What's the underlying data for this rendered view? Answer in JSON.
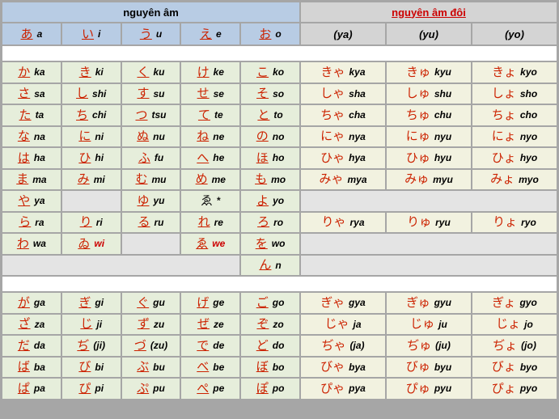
{
  "header": {
    "left_title": "nguyên âm",
    "right_title": "nguyên âm đôi",
    "vowels": [
      {
        "kana": "あ",
        "romaji": "a"
      },
      {
        "kana": "い",
        "romaji": "i"
      },
      {
        "kana": "う",
        "romaji": "u"
      },
      {
        "kana": "え",
        "romaji": "e"
      },
      {
        "kana": "お",
        "romaji": "o"
      }
    ],
    "diphthongs": [
      "(ya)",
      "(yu)",
      "(yo)"
    ]
  },
  "basic_rows": [
    {
      "id": "k",
      "left": [
        {
          "kana": "か",
          "romaji": "ka"
        },
        {
          "kana": "き",
          "romaji": "ki"
        },
        {
          "kana": "く",
          "romaji": "ku"
        },
        {
          "kana": "け",
          "romaji": "ke"
        },
        {
          "kana": "こ",
          "romaji": "ko"
        }
      ],
      "right": [
        {
          "kana": "きゃ",
          "romaji": "kya"
        },
        {
          "kana": "きゅ",
          "romaji": "kyu"
        },
        {
          "kana": "きょ",
          "romaji": "kyo"
        }
      ]
    },
    {
      "id": "s",
      "left": [
        {
          "kana": "さ",
          "romaji": "sa"
        },
        {
          "kana": "し",
          "romaji": "shi"
        },
        {
          "kana": "す",
          "romaji": "su"
        },
        {
          "kana": "せ",
          "romaji": "se"
        },
        {
          "kana": "そ",
          "romaji": "so"
        }
      ],
      "right": [
        {
          "kana": "しゃ",
          "romaji": "sha"
        },
        {
          "kana": "しゅ",
          "romaji": "shu"
        },
        {
          "kana": "しょ",
          "romaji": "sho"
        }
      ]
    },
    {
      "id": "t",
      "left": [
        {
          "kana": "た",
          "romaji": "ta"
        },
        {
          "kana": "ち",
          "romaji": "chi"
        },
        {
          "kana": "つ",
          "romaji": "tsu"
        },
        {
          "kana": "て",
          "romaji": "te"
        },
        {
          "kana": "と",
          "romaji": "to"
        }
      ],
      "right": [
        {
          "kana": "ちゃ",
          "romaji": "cha"
        },
        {
          "kana": "ちゅ",
          "romaji": "chu"
        },
        {
          "kana": "ちょ",
          "romaji": "cho"
        }
      ]
    },
    {
      "id": "n",
      "left": [
        {
          "kana": "な",
          "romaji": "na"
        },
        {
          "kana": "に",
          "romaji": "ni"
        },
        {
          "kana": "ぬ",
          "romaji": "nu"
        },
        {
          "kana": "ね",
          "romaji": "ne"
        },
        {
          "kana": "の",
          "romaji": "no"
        }
      ],
      "right": [
        {
          "kana": "にゃ",
          "romaji": "nya"
        },
        {
          "kana": "にゅ",
          "romaji": "nyu"
        },
        {
          "kana": "にょ",
          "romaji": "nyo"
        }
      ]
    },
    {
      "id": "h",
      "left": [
        {
          "kana": "は",
          "romaji": "ha"
        },
        {
          "kana": "ひ",
          "romaji": "hi"
        },
        {
          "kana": "ふ",
          "romaji": "fu"
        },
        {
          "kana": "へ",
          "romaji": "he"
        },
        {
          "kana": "ほ",
          "romaji": "ho"
        }
      ],
      "right": [
        {
          "kana": "ひゃ",
          "romaji": "hya"
        },
        {
          "kana": "ひゅ",
          "romaji": "hyu"
        },
        {
          "kana": "ひょ",
          "romaji": "hyo"
        }
      ]
    },
    {
      "id": "m",
      "left": [
        {
          "kana": "ま",
          "romaji": "ma"
        },
        {
          "kana": "み",
          "romaji": "mi"
        },
        {
          "kana": "む",
          "romaji": "mu"
        },
        {
          "kana": "め",
          "romaji": "me"
        },
        {
          "kana": "も",
          "romaji": "mo"
        }
      ],
      "right": [
        {
          "kana": "みゃ",
          "romaji": "mya"
        },
        {
          "kana": "みゅ",
          "romaji": "myu"
        },
        {
          "kana": "みょ",
          "romaji": "myo"
        }
      ]
    },
    {
      "id": "y",
      "left": [
        {
          "kana": "や",
          "romaji": "ya"
        },
        {
          "empty": true
        },
        {
          "kana": "ゆ",
          "romaji": "yu"
        },
        {
          "kana": "ゑ",
          "romaji": "",
          "black": true,
          "mark": "*"
        },
        {
          "kana": "よ",
          "romaji": "yo"
        }
      ],
      "right": [
        {
          "empty": true
        }
      ]
    },
    {
      "id": "r",
      "left": [
        {
          "kana": "ら",
          "romaji": "ra"
        },
        {
          "kana": "り",
          "romaji": "ri"
        },
        {
          "kana": "る",
          "romaji": "ru"
        },
        {
          "kana": "れ",
          "romaji": "re"
        },
        {
          "kana": "ろ",
          "romaji": "ro"
        }
      ],
      "right": [
        {
          "kana": "りゃ",
          "romaji": "rya"
        },
        {
          "kana": "りゅ",
          "romaji": "ryu"
        },
        {
          "kana": "りょ",
          "romaji": "ryo"
        }
      ]
    },
    {
      "id": "w",
      "left": [
        {
          "kana": "わ",
          "romaji": "wa"
        },
        {
          "kana": "ゐ",
          "romaji": "wi",
          "red_romaji": true
        },
        {
          "empty": true
        },
        {
          "kana": "ゑ",
          "romaji": "we",
          "red_romaji": true
        },
        {
          "kana": "を",
          "romaji": "wo"
        }
      ],
      "right": [
        {
          "empty": true
        }
      ]
    },
    {
      "id": "nn",
      "left": [
        {
          "empty_wide": true
        },
        {
          "kana": "ん",
          "romaji": "n"
        }
      ],
      "right": [
        {
          "empty": true
        }
      ]
    }
  ],
  "dakuten_rows": [
    {
      "id": "g",
      "left": [
        {
          "kana": "が",
          "romaji": "ga"
        },
        {
          "kana": "ぎ",
          "romaji": "gi"
        },
        {
          "kana": "ぐ",
          "romaji": "gu"
        },
        {
          "kana": "げ",
          "romaji": "ge"
        },
        {
          "kana": "ご",
          "romaji": "go"
        }
      ],
      "right": [
        {
          "kana": "ぎゃ",
          "romaji": "gya"
        },
        {
          "kana": "ぎゅ",
          "romaji": "gyu"
        },
        {
          "kana": "ぎょ",
          "romaji": "gyo"
        }
      ]
    },
    {
      "id": "z",
      "left": [
        {
          "kana": "ざ",
          "romaji": "za"
        },
        {
          "kana": "じ",
          "romaji": "ji"
        },
        {
          "kana": "ず",
          "romaji": "zu"
        },
        {
          "kana": "ぜ",
          "romaji": "ze"
        },
        {
          "kana": "ぞ",
          "romaji": "zo"
        }
      ],
      "right": [
        {
          "kana": "じゃ",
          "romaji": "ja"
        },
        {
          "kana": "じゅ",
          "romaji": "ju"
        },
        {
          "kana": "じょ",
          "romaji": "jo"
        }
      ]
    },
    {
      "id": "d",
      "left": [
        {
          "kana": "だ",
          "romaji": "da"
        },
        {
          "kana": "ぢ",
          "romaji": "(ji)"
        },
        {
          "kana": "づ",
          "romaji": "(zu)"
        },
        {
          "kana": "で",
          "romaji": "de"
        },
        {
          "kana": "ど",
          "romaji": "do"
        }
      ],
      "right": [
        {
          "kana": "ぢゃ",
          "romaji": "(ja)"
        },
        {
          "kana": "ぢゅ",
          "romaji": "(ju)"
        },
        {
          "kana": "ぢょ",
          "romaji": "(jo)"
        }
      ]
    },
    {
      "id": "b",
      "left": [
        {
          "kana": "ば",
          "romaji": "ba"
        },
        {
          "kana": "び",
          "romaji": "bi"
        },
        {
          "kana": "ぶ",
          "romaji": "bu"
        },
        {
          "kana": "べ",
          "romaji": "be"
        },
        {
          "kana": "ぼ",
          "romaji": "bo"
        }
      ],
      "right": [
        {
          "kana": "びゃ",
          "romaji": "bya"
        },
        {
          "kana": "びゅ",
          "romaji": "byu"
        },
        {
          "kana": "びょ",
          "romaji": "byo"
        }
      ]
    },
    {
      "id": "p",
      "left": [
        {
          "kana": "ぱ",
          "romaji": "pa"
        },
        {
          "kana": "ぴ",
          "romaji": "pi"
        },
        {
          "kana": "ぷ",
          "romaji": "pu"
        },
        {
          "kana": "ぺ",
          "romaji": "pe"
        },
        {
          "kana": "ぽ",
          "romaji": "po"
        }
      ],
      "right": [
        {
          "kana": "ぴゃ",
          "romaji": "pya"
        },
        {
          "kana": "ぴゅ",
          "romaji": "pyu"
        },
        {
          "kana": "ぴょ",
          "romaji": "pyo"
        }
      ]
    }
  ],
  "colors": {
    "kana_red": "#cc2200",
    "title_red": "#cc0000",
    "vowel_header_bg": "#b8cce4",
    "diphthong_header_bg": "#d4d4d4",
    "basic_cell_bg": "#e6eedb",
    "diphthong_cell_bg": "#f2f2e0",
    "empty_cell_bg": "#e4e4e4",
    "border": "#a6a6a6"
  }
}
